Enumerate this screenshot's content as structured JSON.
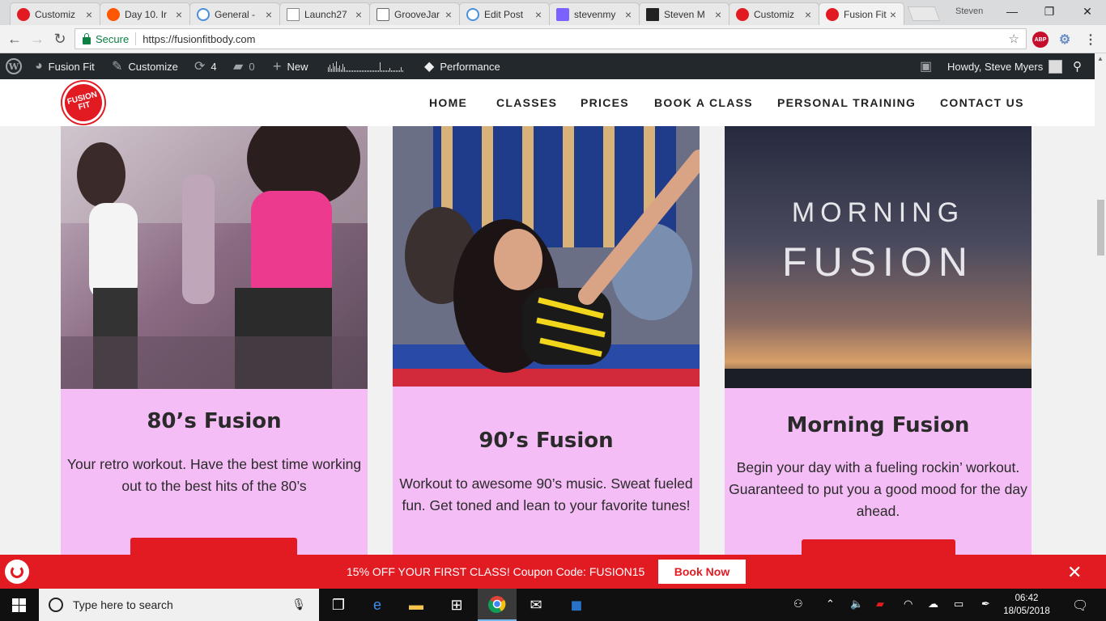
{
  "browser": {
    "tabs": [
      {
        "title": "Customiz",
        "color": "#e21b23"
      },
      {
        "title": "Day 10. Ir",
        "color": "#ff5700"
      },
      {
        "title": "General -",
        "color": "#4a90d9"
      },
      {
        "title": "Launch27",
        "color": "#888888"
      },
      {
        "title": "GrooveJar",
        "color": "#888888"
      },
      {
        "title": "Edit Post",
        "color": "#4a90d9"
      },
      {
        "title": "stevenmy",
        "color": "#7b61ff"
      },
      {
        "title": "Steven M",
        "color": "#222222"
      },
      {
        "title": "Customiz",
        "color": "#e21b23"
      },
      {
        "title": "Fusion Fit",
        "color": "#e21b23"
      }
    ],
    "profile_name": "Steven",
    "security_label": "Secure",
    "url": "https://fusionfitbody.com",
    "ext_abp": "ABP"
  },
  "adminbar": {
    "site_name": "Fusion Fit",
    "customize": "Customize",
    "updates_count": "4",
    "comments_count": "0",
    "new_label": "New",
    "performance": "Performance",
    "howdy": "Howdy, Steve Myers"
  },
  "site": {
    "logo_text": "FUSION FIT",
    "nav": [
      "HOME",
      "CLASSES",
      "PRICES",
      "BOOK A CLASS",
      "PERSONAL TRAINING",
      "CONTACT US"
    ]
  },
  "classes": [
    {
      "title": "80’s Fusion",
      "description": "Your retro workout. Have the best time working out to the best hits of the 80’s"
    },
    {
      "title": "90’s Fusion",
      "description": "Workout to awesome 90’s music. Sweat fueled fun. Get toned and lean to your favorite tunes!"
    },
    {
      "title": "Morning Fusion",
      "description": "Begin your day with a fueling rockin’ workout. Guaranteed to put you a good mood for the day ahead.",
      "image_line1": "MORNING",
      "image_line2": "FUSION"
    }
  ],
  "promo": {
    "text": "15% OFF YOUR FIRST CLASS! Coupon Code: FUSION15",
    "button": "Book Now"
  },
  "taskbar": {
    "search_placeholder": "Type here to search",
    "time": "06:42",
    "date": "18/05/2018"
  },
  "colors": {
    "brand_red": "#e21b23",
    "card_pink": "#f5bdf5",
    "adminbar": "#23282d"
  }
}
